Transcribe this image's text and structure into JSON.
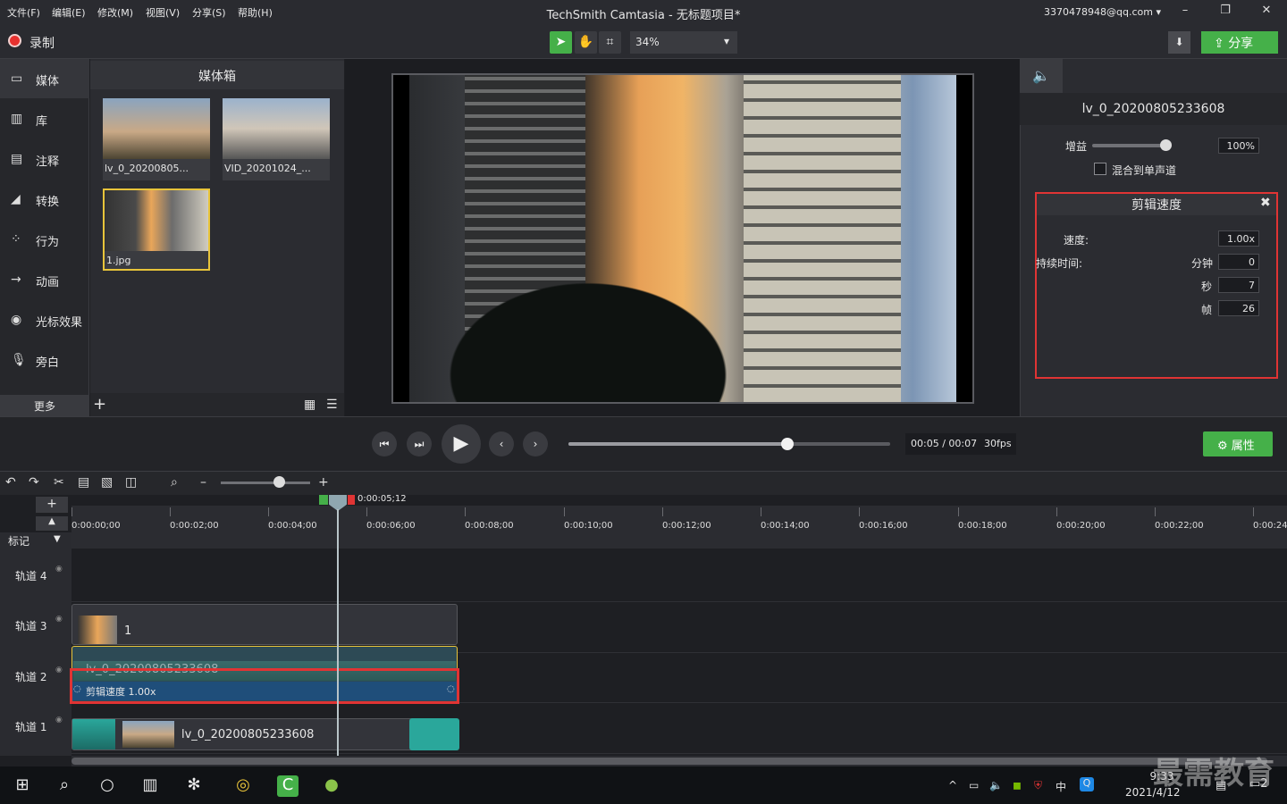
{
  "menu": [
    "文件(F)",
    "编辑(E)",
    "修改(M)",
    "视图(V)",
    "分享(S)",
    "帮助(H)"
  ],
  "window_title": "TechSmith Camtasia - 无标题项目*",
  "account": "3370478948@qq.com",
  "toolbar": {
    "record_label": "录制",
    "zoom": "34%",
    "share_label": "分享"
  },
  "nav": {
    "items": [
      {
        "label": "媒体",
        "icon": "media-icon"
      },
      {
        "label": "库",
        "icon": "library-icon"
      },
      {
        "label": "注释",
        "icon": "annotation-icon"
      },
      {
        "label": "转换",
        "icon": "transition-icon"
      },
      {
        "label": "行为",
        "icon": "behavior-icon"
      },
      {
        "label": "动画",
        "icon": "animation-icon"
      },
      {
        "label": "光标效果",
        "icon": "cursor-effect-icon"
      },
      {
        "label": "旁白",
        "icon": "microphone-icon"
      }
    ],
    "more": "更多"
  },
  "media_bin": {
    "title": "媒体箱",
    "items": [
      {
        "label": "lv_0_20200805..."
      },
      {
        "label": "VID_20201024_..."
      },
      {
        "label": "1.jpg"
      }
    ]
  },
  "properties": {
    "clip_name": "lv_0_20200805233608",
    "gain_label": "增益",
    "gain_value": "100%",
    "gain_level": 0.9,
    "mono_label": "混合到单声道",
    "speed_panel": {
      "title": "剪辑速度",
      "speed_label": "速度:",
      "speed_value": "1.00x",
      "duration_label": "持续时间:",
      "min_label": "分钟",
      "min_value": "0",
      "sec_label": "秒",
      "sec_value": "7",
      "frame_label": "帧",
      "frame_value": "26"
    }
  },
  "playback": {
    "time": "00:05 / 00:07",
    "fps": "30fps",
    "progress": 0.68,
    "props_button": "属性"
  },
  "timeline": {
    "playhead_time": "0:00:05;12",
    "ticks": [
      "0:00:00;00",
      "0:00:02;00",
      "0:00:04;00",
      "0:00:06;00",
      "0:00:08;00",
      "0:00:10;00",
      "0:00:12;00",
      "0:00:14;00",
      "0:00:16;00",
      "0:00:18;00",
      "0:00:20;00",
      "0:00:22;00",
      "0:00:24"
    ],
    "marker_label": "标记",
    "tracks": [
      "轨道 4",
      "轨道 3",
      "轨道 2",
      "轨道 1"
    ],
    "clip_track3": "1",
    "clip_track2": "lv_0_20200805233608",
    "speed_bar": "剪辑速度 1.00x",
    "clip_track1": "lv_0_20200805233608"
  },
  "taskbar": {
    "time": "9:33",
    "date": "2021/4/12",
    "ime": "中",
    "notifications": "2"
  },
  "watermark": "最需教育"
}
